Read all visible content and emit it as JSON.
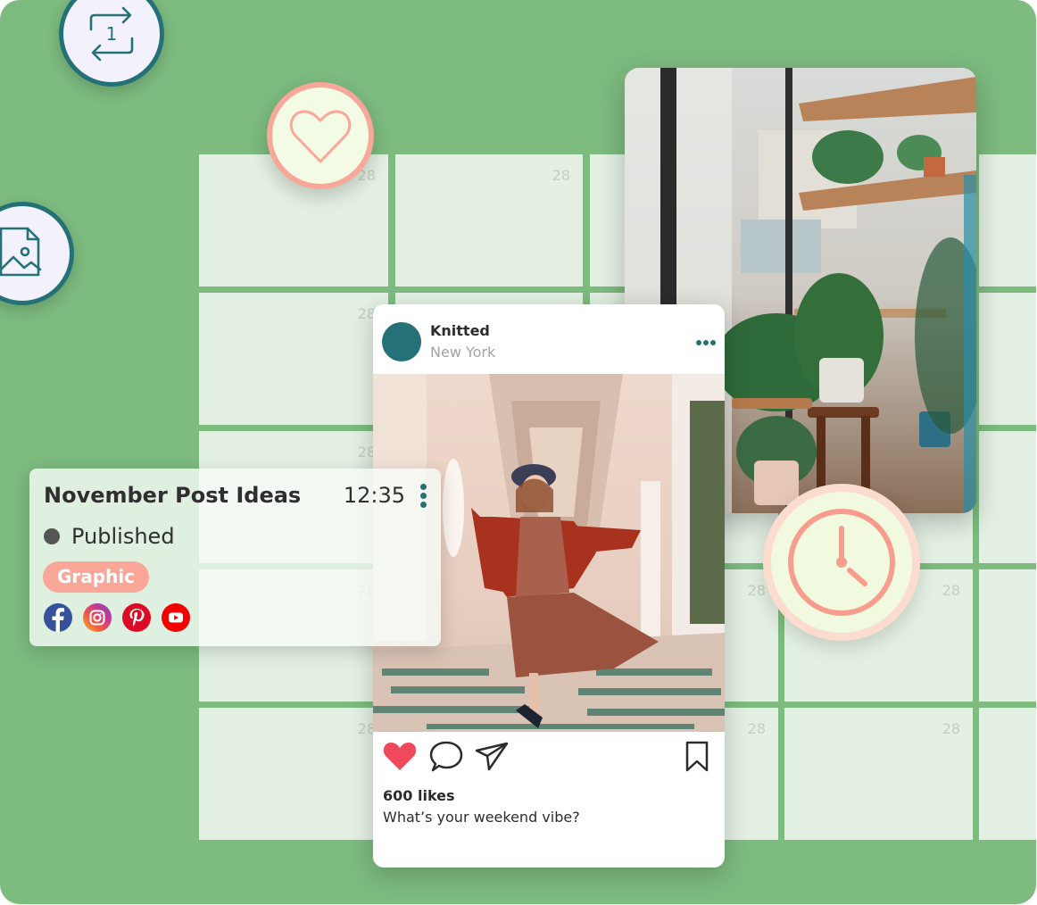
{
  "calendar": {
    "day_number": "28",
    "cells": [
      {
        "row": 0,
        "col": 0,
        "label": "28"
      },
      {
        "row": 0,
        "col": 1,
        "label": "28"
      },
      {
        "row": 0,
        "col": 2,
        "label": ""
      },
      {
        "row": 0,
        "col": 3,
        "label": ""
      },
      {
        "row": 0,
        "col": 4,
        "label": ""
      },
      {
        "row": 1,
        "col": 0,
        "label": "28"
      },
      {
        "row": 1,
        "col": 1,
        "label": ""
      },
      {
        "row": 1,
        "col": 2,
        "label": ""
      },
      {
        "row": 1,
        "col": 3,
        "label": ""
      },
      {
        "row": 1,
        "col": 4,
        "label": ""
      },
      {
        "row": 2,
        "col": 0,
        "label": "28"
      },
      {
        "row": 2,
        "col": 1,
        "label": ""
      },
      {
        "row": 2,
        "col": 2,
        "label": ""
      },
      {
        "row": 2,
        "col": 3,
        "label": ""
      },
      {
        "row": 2,
        "col": 4,
        "label": ""
      },
      {
        "row": 3,
        "col": 0,
        "label": "28"
      },
      {
        "row": 3,
        "col": 1,
        "label": ""
      },
      {
        "row": 3,
        "col": 2,
        "label": "28"
      },
      {
        "row": 3,
        "col": 3,
        "label": "28"
      },
      {
        "row": 3,
        "col": 4,
        "label": ""
      },
      {
        "row": 4,
        "col": 0,
        "label": "28"
      },
      {
        "row": 4,
        "col": 1,
        "label": ""
      },
      {
        "row": 4,
        "col": 2,
        "label": "28"
      },
      {
        "row": 4,
        "col": 3,
        "label": "28"
      },
      {
        "row": 4,
        "col": 4,
        "label": ""
      }
    ]
  },
  "floating_icons": {
    "repeat": "repeat-once-icon",
    "image_file": "image-file-icon",
    "heart": "heart-icon",
    "clock": "clock-icon"
  },
  "post": {
    "account_name": "Knitted",
    "location": "New York",
    "likes": "600 likes",
    "caption": "What’s your weekend vibe?",
    "liked": true
  },
  "task_card": {
    "title": "November Post Ideas",
    "time": "12:35",
    "status": "Published",
    "tag": "Graphic",
    "networks": [
      "Facebook",
      "Instagram",
      "Pinterest",
      "YouTube"
    ]
  },
  "colors": {
    "background": "#7dbb7f",
    "cell": "#e4f0e4",
    "teal": "#257178",
    "coral": "#f9a798",
    "like_red": "#ef4a5b"
  }
}
